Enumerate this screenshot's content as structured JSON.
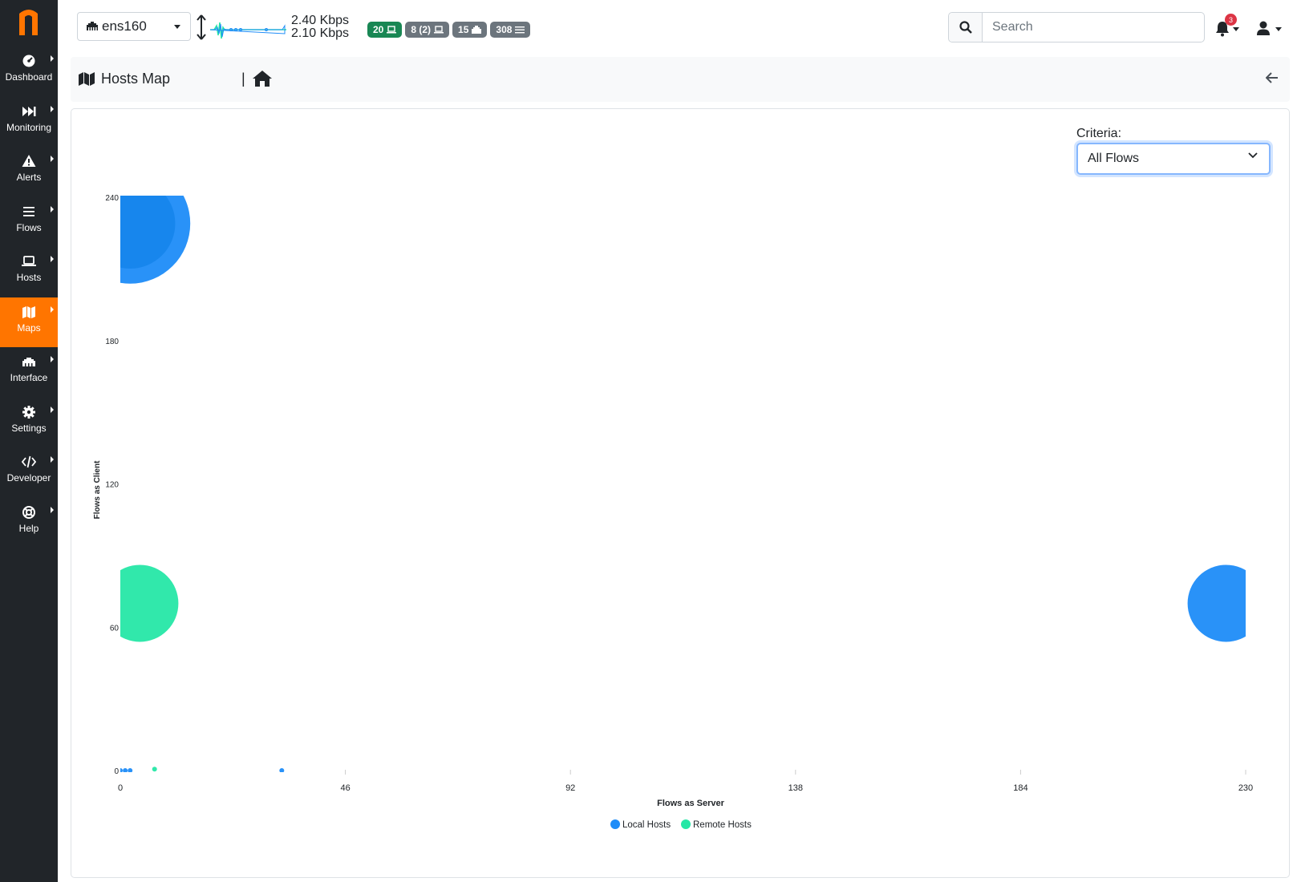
{
  "app": {
    "logo_letter": "n",
    "brand_color": "#ff7500"
  },
  "sidebar": {
    "items": [
      {
        "label": "Dashboard",
        "icon": "gauge-icon"
      },
      {
        "label": "Monitoring",
        "icon": "fast-forward-icon"
      },
      {
        "label": "Alerts",
        "icon": "warning-icon"
      },
      {
        "label": "Flows",
        "icon": "bars-icon"
      },
      {
        "label": "Hosts",
        "icon": "laptop-icon"
      },
      {
        "label": "Maps",
        "icon": "map-icon",
        "active": true
      },
      {
        "label": "Interface",
        "icon": "ethernet-icon"
      },
      {
        "label": "Settings",
        "icon": "gear-icon"
      },
      {
        "label": "Developer",
        "icon": "code-icon"
      },
      {
        "label": "Help",
        "icon": "life-ring-icon"
      }
    ]
  },
  "topbar": {
    "interface": "ens160",
    "throughput_up": "2.40 Kbps",
    "throughput_down": "2.10 Kbps",
    "badges": [
      {
        "value": "20",
        "icon": "laptop-icon",
        "color": "#198754"
      },
      {
        "value": "8 (2)",
        "icon": "laptop-icon",
        "color": "#6c757d"
      },
      {
        "value": "15",
        "icon": "ethernet-icon",
        "color": "#6c757d"
      },
      {
        "value": "308",
        "icon": "bars-icon",
        "color": "#6c757d"
      }
    ],
    "search_placeholder": "Search",
    "alerts_count": "3"
  },
  "breadcrumb": {
    "title": "Hosts Map",
    "separator": "|"
  },
  "criteria": {
    "label": "Criteria:",
    "selected": "All Flows"
  },
  "chart_data": {
    "type": "bubble",
    "xlabel": "Flows as Server",
    "ylabel": "Flows as Client",
    "xlim": [
      0,
      230
    ],
    "ylim": [
      0,
      240
    ],
    "xticks": [
      "0",
      "46",
      "92",
      "138",
      "184",
      "230"
    ],
    "yticks": [
      "0",
      "60",
      "120",
      "180",
      "240"
    ],
    "legend_position": "bottom-center",
    "series": [
      {
        "name": "Local Hosts",
        "color": "#1d8cf8",
        "points": [
          {
            "x": 2,
            "y": 229,
            "r": 25
          },
          {
            "x": 226,
            "y": 70,
            "r": 16
          },
          {
            "x": 0,
            "y": 0,
            "r": 1
          },
          {
            "x": 1,
            "y": 0,
            "r": 1
          },
          {
            "x": 2,
            "y": 0,
            "r": 1
          },
          {
            "x": 33,
            "y": 0,
            "r": 1
          }
        ]
      },
      {
        "name": "Remote Hosts",
        "color": "#26e7a6",
        "points": [
          {
            "x": 4,
            "y": 70,
            "r": 16
          },
          {
            "x": 7,
            "y": 0.6,
            "r": 1
          }
        ]
      }
    ]
  }
}
